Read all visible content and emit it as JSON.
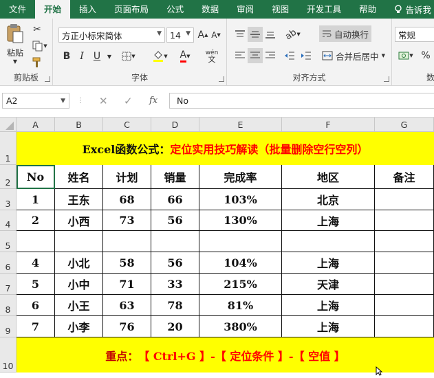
{
  "menu": {
    "tabs": [
      "文件",
      "开始",
      "插入",
      "页面布局",
      "公式",
      "数据",
      "审阅",
      "视图",
      "开发工具",
      "帮助"
    ],
    "active_tab": "开始",
    "tell_me": "告诉我"
  },
  "ribbon": {
    "clipboard": {
      "paste_label": "粘贴",
      "title": "剪贴板"
    },
    "font": {
      "font_name": "方正小标宋简体",
      "font_size": "14",
      "title": "字体",
      "bold": "B",
      "italic": "I",
      "underline": "U",
      "phonetic": "wén"
    },
    "alignment": {
      "wrap_text": "自动换行",
      "merge_center": "合并后居中",
      "title": "对齐方式"
    },
    "number": {
      "format": "常规",
      "title": "数",
      "percent": "%"
    }
  },
  "formula_bar": {
    "name_box": "A2",
    "fx": "fx",
    "content": "No"
  },
  "columns": [
    "A",
    "B",
    "C",
    "D",
    "E",
    "F",
    "G"
  ],
  "rows": [
    "1",
    "2",
    "3",
    "4",
    "5",
    "6",
    "7",
    "8",
    "9",
    "10"
  ],
  "sheet": {
    "title_black": "Excel函数公式：",
    "title_red": "定位实用技巧解读（批量删除空行空列）",
    "headers": [
      "No",
      "姓名",
      "计划",
      "销量",
      "完成率",
      "地区",
      "备注"
    ],
    "data": [
      [
        "1",
        "王东",
        "68",
        "66",
        "103%",
        "北京",
        ""
      ],
      [
        "2",
        "小西",
        "73",
        "56",
        "130%",
        "上海",
        ""
      ],
      [
        "",
        "",
        "",
        "",
        "",
        "",
        ""
      ],
      [
        "4",
        "小北",
        "58",
        "56",
        "104%",
        "上海",
        ""
      ],
      [
        "5",
        "小中",
        "71",
        "33",
        "215%",
        "天津",
        ""
      ],
      [
        "6",
        "小王",
        "63",
        "78",
        "81%",
        "上海",
        ""
      ],
      [
        "7",
        "小李",
        "76",
        "20",
        "380%",
        "上海",
        ""
      ]
    ],
    "footer_prefix": "重点：",
    "footer_body": "【 Ctrl+G 】-【 定位条件 】-【 空值 】"
  },
  "colors": {
    "excel_green": "#217346",
    "highlight_yellow": "#ffff00",
    "accent_red": "#ff0000",
    "error_triangle": "#1e7f3a"
  }
}
